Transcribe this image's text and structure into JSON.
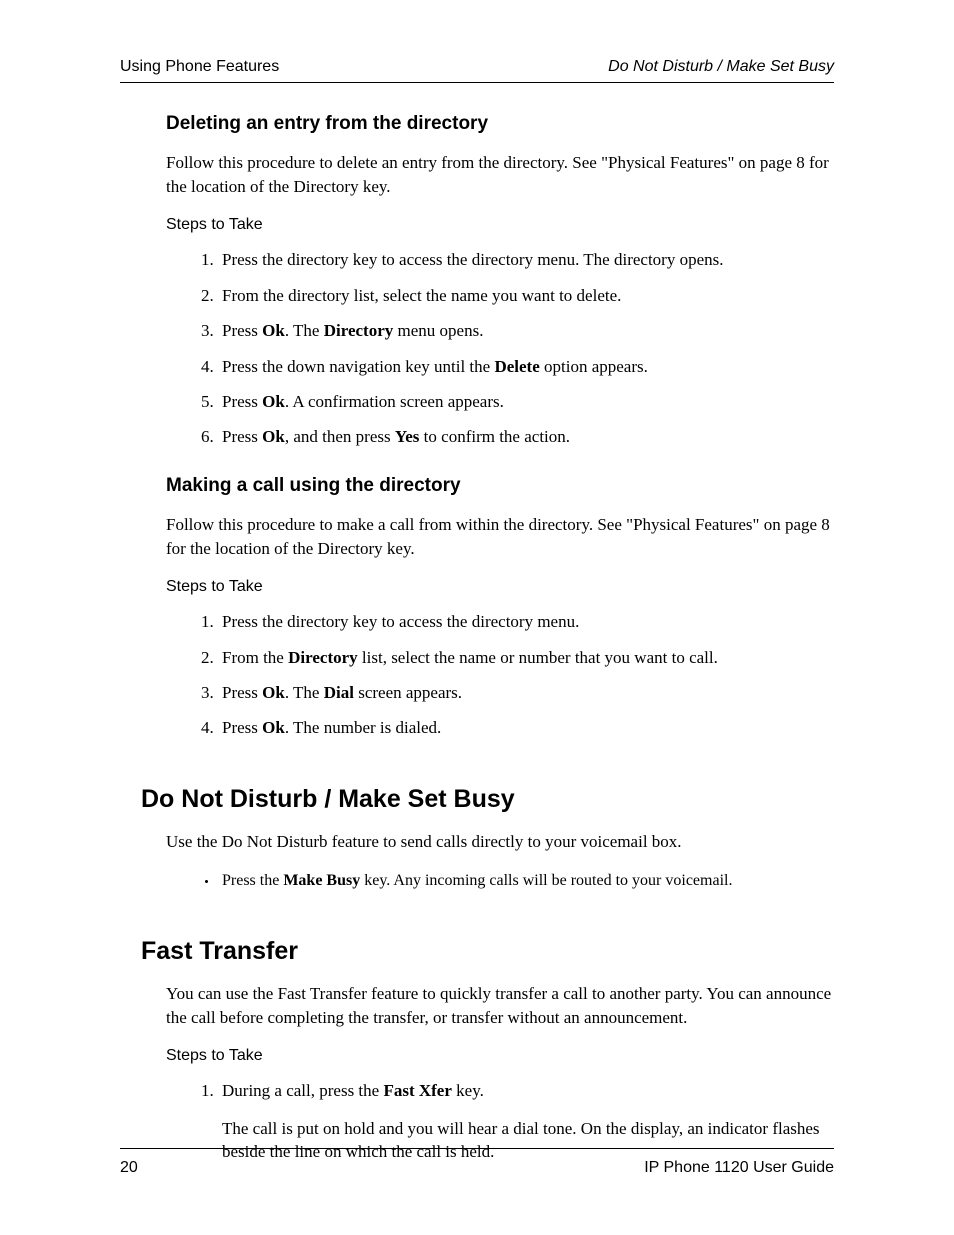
{
  "header": {
    "left": "Using Phone Features",
    "right": "Do Not Disturb / Make Set Busy"
  },
  "sec1": {
    "title": "Deleting an entry from the directory",
    "intro": "Follow this procedure to delete an entry from the directory. See \"Physical Features\" on page 8 for the location of the Directory key.",
    "stepsLabel": "Steps to Take",
    "steps": {
      "s1": "Press the directory key to access the directory menu. The directory opens.",
      "s2": "From the directory list, select the name you want to delete.",
      "s3a": "Press ",
      "s3b": "Ok",
      "s3c": ". The ",
      "s3d": "Directory",
      "s3e": " menu opens.",
      "s4a": "Press the down navigation key until the ",
      "s4b": "Delete",
      "s4c": " option appears.",
      "s5a": "Press ",
      "s5b": "Ok",
      "s5c": ". A confirmation screen appears.",
      "s6a": "Press ",
      "s6b": "Ok",
      "s6c": ", and then press ",
      "s6d": "Yes",
      "s6e": " to confirm the action."
    }
  },
  "sec2": {
    "title": "Making a call using the directory",
    "intro": "Follow this procedure to make a call from within the directory. See \"Physical Features\" on page 8 for the location of the Directory key.",
    "stepsLabel": "Steps to Take",
    "steps": {
      "s1": "Press the directory key to access the directory menu.",
      "s2a": "From the ",
      "s2b": "Directory",
      "s2c": " list, select the name or number that you want to call.",
      "s3a": "Press ",
      "s3b": "Ok",
      "s3c": ". The ",
      "s3d": "Dial",
      "s3e": " screen appears.",
      "s4a": "Press ",
      "s4b": "Ok",
      "s4c": ". The number is dialed."
    }
  },
  "sec3": {
    "title": "Do Not Disturb / Make Set Busy",
    "intro": "Use the Do Not Disturb feature to send calls directly to your voicemail box.",
    "bullet": {
      "a": "Press the ",
      "b": "Make Busy",
      "c": " key. Any incoming calls will be routed to your voicemail."
    }
  },
  "sec4": {
    "title": "Fast Transfer",
    "intro": "You can use the Fast Transfer feature to quickly transfer a call to another party. You can announce the call before completing the transfer, or transfer without an announcement.",
    "stepsLabel": "Steps to Take",
    "steps": {
      "s1a": "During a call, press the ",
      "s1b": "Fast Xfer",
      "s1c": " key.",
      "s1sub": "The call is put on hold and you will hear a dial tone. On the display, an indicator flashes beside the line on which the call is held."
    }
  },
  "footer": {
    "page": "20",
    "doc": "IP Phone 1120 User Guide"
  }
}
